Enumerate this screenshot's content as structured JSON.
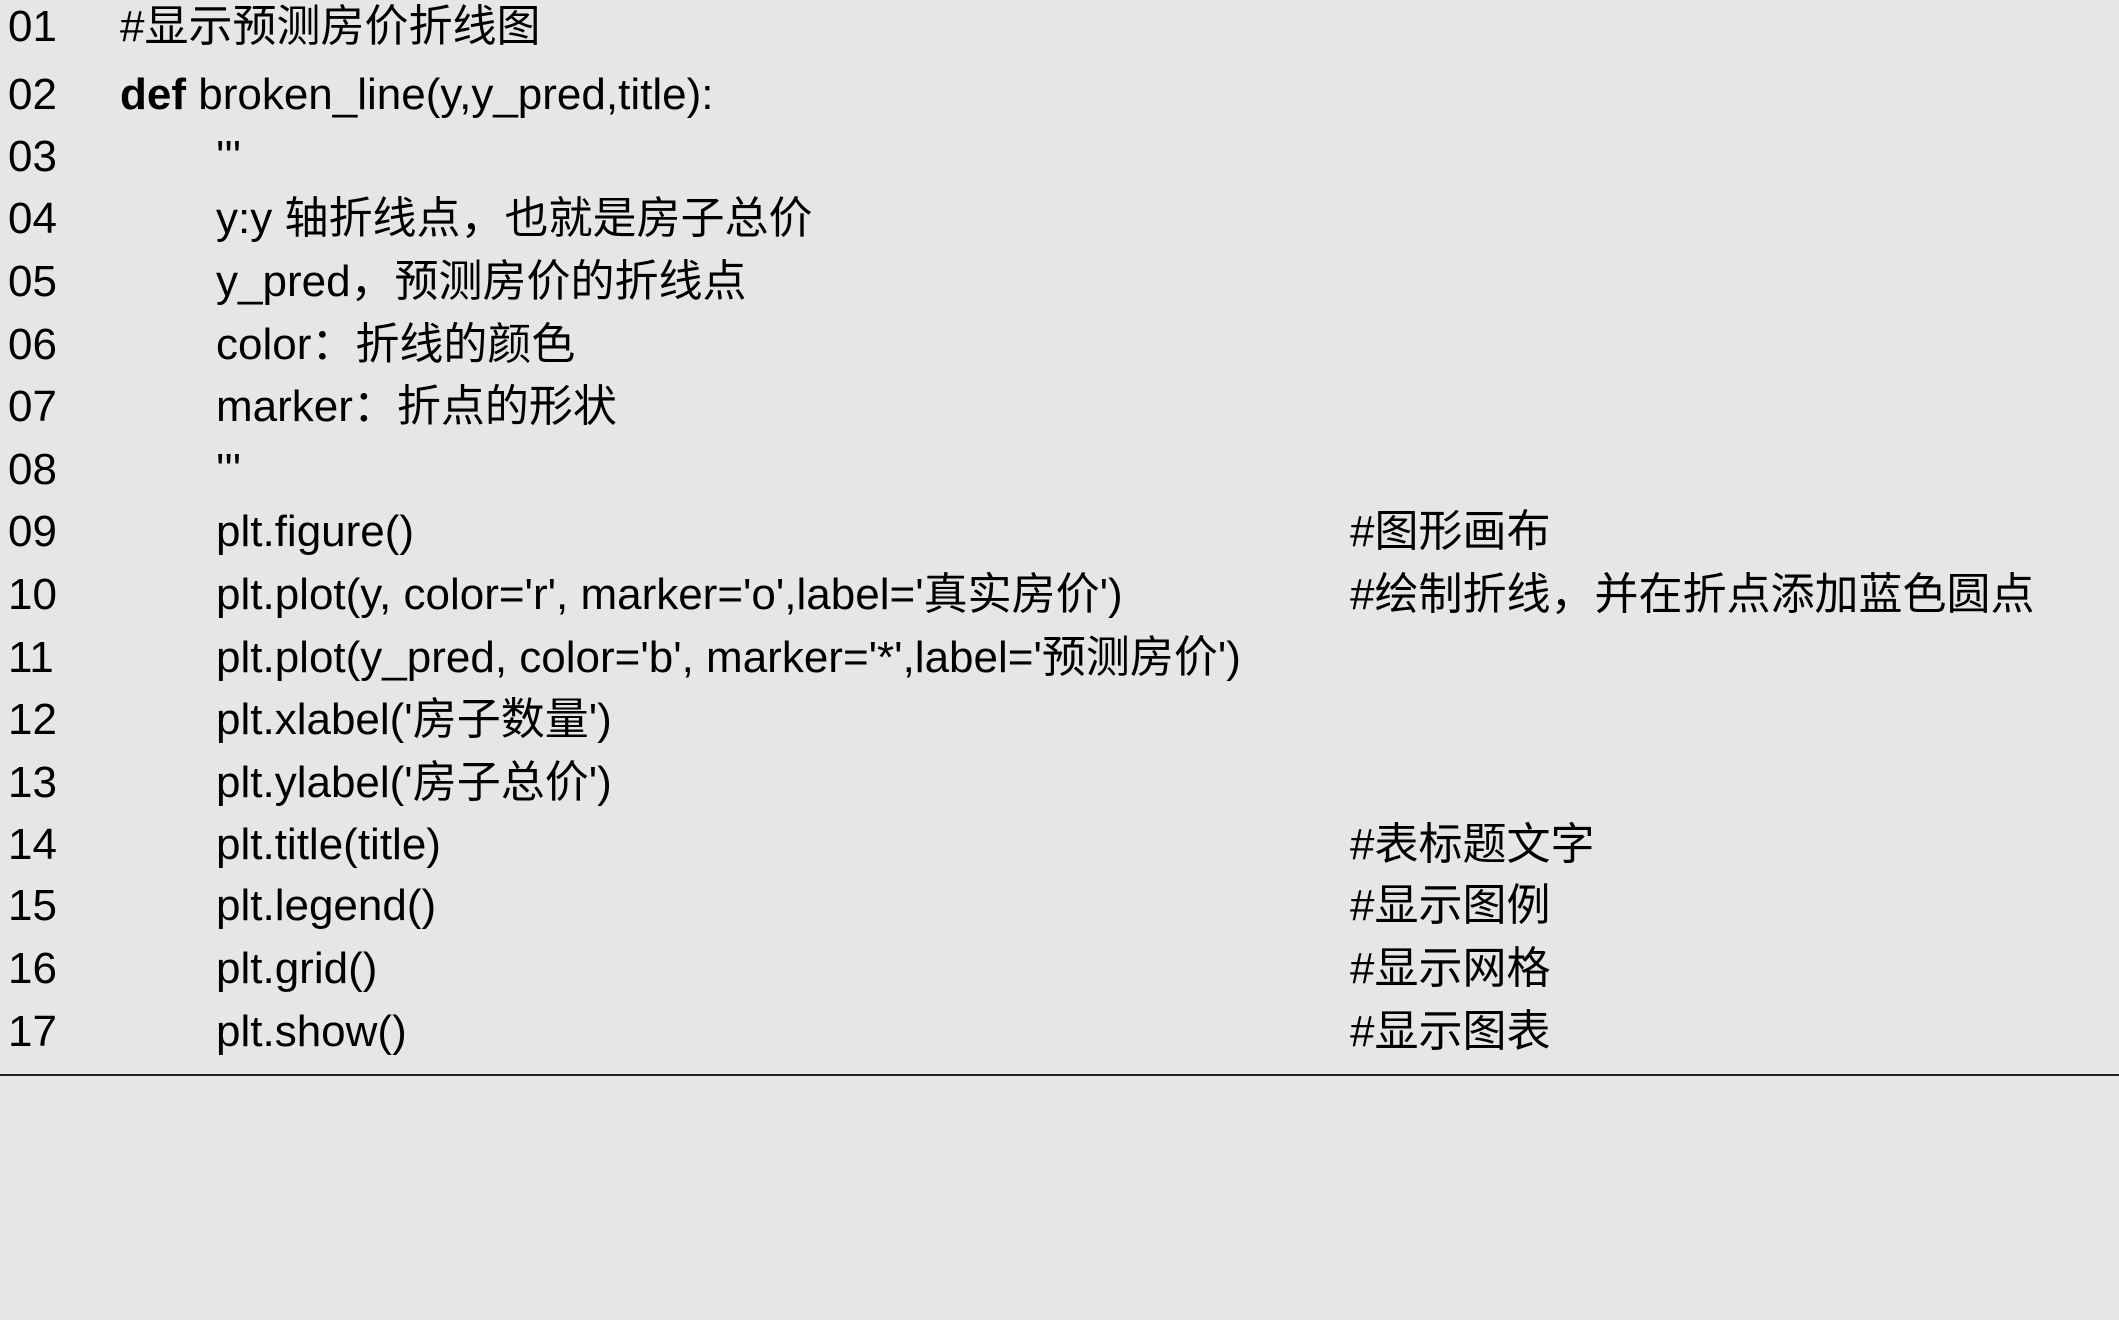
{
  "lines": [
    {
      "num": "01",
      "code": "#显示预测房价折线图",
      "comment": ""
    },
    {
      "num": "02",
      "keyword": "def",
      "code": " broken_line(y,y_pred,title):",
      "comment": ""
    },
    {
      "num": "03",
      "code": "'''",
      "comment": ""
    },
    {
      "num": "04",
      "code": "y:y 轴折线点，也就是房子总价",
      "comment": ""
    },
    {
      "num": "05",
      "code": "y_pred，预测房价的折线点",
      "comment": ""
    },
    {
      "num": "06",
      "code": "color：折线的颜色",
      "comment": ""
    },
    {
      "num": "07",
      "code": "marker：折点的形状",
      "comment": ""
    },
    {
      "num": "08",
      "code": "'''",
      "comment": ""
    },
    {
      "num": "09",
      "code": "plt.figure()",
      "comment": "#图形画布"
    },
    {
      "num": "10",
      "code": "plt.plot(y, color='r', marker='o',label='真实房价')",
      "comment": "#绘制折线，并在折点添加蓝色圆点"
    },
    {
      "num": "11",
      "code": "plt.plot(y_pred, color='b', marker='*',label='预测房价')",
      "comment": ""
    },
    {
      "num": "12",
      "code": "plt.xlabel('房子数量')",
      "comment": ""
    },
    {
      "num": "13",
      "code": "plt.ylabel('房子总价')",
      "comment": ""
    },
    {
      "num": "14",
      "code": "plt.title(title)",
      "comment": "#表标题文字"
    },
    {
      "num": "15",
      "code": "plt.legend()",
      "comment": "#显示图例"
    },
    {
      "num": "16",
      "code": "plt.grid()",
      "comment": "#显示网格"
    },
    {
      "num": "17",
      "code": "plt.show()",
      "comment": "#显示图表"
    }
  ],
  "colors": {
    "background": "#e6e6e6",
    "text": "#000000"
  }
}
